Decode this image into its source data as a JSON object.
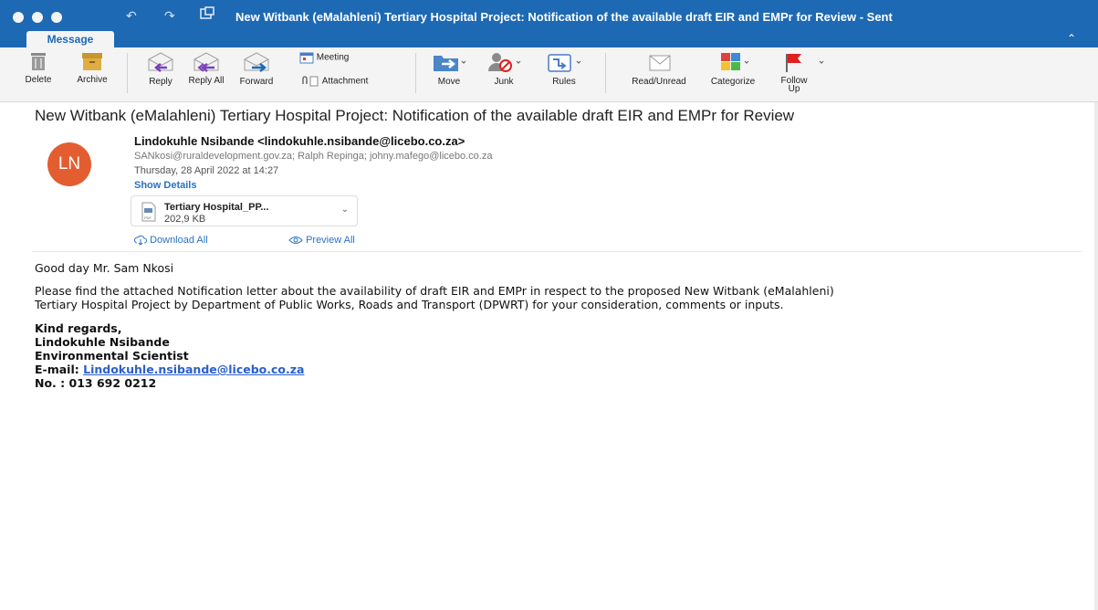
{
  "window": {
    "title": "New Witbank (eMalahleni) Tertiary Hospital Project: Notification of the available draft EIR and EMPr for Review - Sent"
  },
  "tabs": {
    "active": "Message"
  },
  "ribbon": {
    "delete": "Delete",
    "archive": "Archive",
    "reply": "Reply",
    "reply_all": "Reply All",
    "forward": "Forward",
    "meeting": "Meeting",
    "attachment": "Attachment",
    "move": "Move",
    "junk": "Junk",
    "rules": "Rules",
    "read_unread": "Read/Unread",
    "categorize": "Categorize",
    "follow_up": "Follow Up"
  },
  "message": {
    "subject": "New Witbank (eMalahleni) Tertiary Hospital Project: Notification of the available draft EIR and EMPr for Review",
    "avatar_initials": "LN",
    "avatar_color": "#e35d30",
    "from": "Lindokuhle Nsibande <lindokuhle.nsibande@licebo.co.za>",
    "to": "SANkosi@ruraldevelopment.gov.za;  Ralph Repinga;  johny.mafego@licebo.co.za",
    "date": "Thursday, 28 April 2022 at 14:27",
    "show_details": "Show Details",
    "attachment": {
      "name": "Tertiary Hospital_PP...",
      "size": "202,9 KB",
      "type_label": "PDF"
    },
    "download_all": "Download All",
    "preview_all": "Preview All"
  },
  "body": {
    "greeting": "Good day Mr. Sam Nkosi",
    "para_line1": "Please find the attached Notification letter about the availability of draft EIR and EMPr in respect to the proposed New Witbank (eMalahleni)",
    "para_line2": "Tertiary Hospital Project by Department of Public Works, Roads and Transport (DPWRT) for your consideration, comments or inputs.",
    "regards": "Kind regards,",
    "sig_name": "Lindokuhle Nsibande",
    "sig_title": "Environmental Scientist",
    "email_label": "E-mail: ",
    "email": "Lindokuhle.nsibande@licebo.co.za",
    "phone": "No. : 013 692 0212"
  },
  "colors": {
    "titlebar": "#1d69b4",
    "link": "#2a72c4",
    "avatar": "#e35d30",
    "flag": "#e02020"
  }
}
